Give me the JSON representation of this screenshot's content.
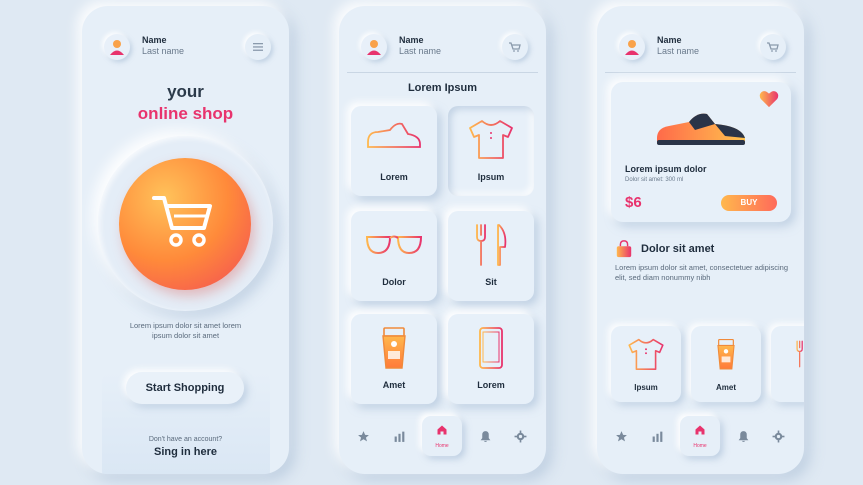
{
  "colors": {
    "accent": "#e8336d",
    "orange": "#ff8a3a",
    "background": "#dfe9f3",
    "panel": "#e6eff8"
  },
  "user": {
    "name": "Name",
    "last": "Last name"
  },
  "screen1": {
    "title_line1": "your",
    "title_line2": "online shop",
    "description": "Lorem ipsum dolor sit amet lorem ipsum dolor sit amet",
    "start_button": "Start Shopping",
    "no_account": "Don't have an account?",
    "sign_in": "Sing in here",
    "header_icon": "menu-icon"
  },
  "screen2": {
    "title": "Lorem Ipsum",
    "header_icon": "cart-icon",
    "categories": [
      {
        "label": "Lorem",
        "icon": "sneaker-icon"
      },
      {
        "label": "Ipsum",
        "icon": "tshirt-icon"
      },
      {
        "label": "Dolor",
        "icon": "glasses-icon"
      },
      {
        "label": "Sit",
        "icon": "cutlery-icon"
      },
      {
        "label": "Amet",
        "icon": "cream-tube-icon"
      },
      {
        "label": "Lorem",
        "icon": "phone-icon"
      }
    ]
  },
  "screen3": {
    "header_icon": "cart-icon",
    "product": {
      "name": "Lorem ipsum dolor",
      "subtitle": "Dolor sit amet: 300 ml",
      "price": "$6",
      "buy": "BUY"
    },
    "section_title": "Dolor sit amet",
    "section_desc": "Lorem ipsum dolor sit amet, consectetuer adipiscing elit, sed diam nonummy nibh",
    "items": [
      {
        "label": "Ipsum",
        "icon": "tshirt-icon"
      },
      {
        "label": "Amet",
        "icon": "cream-tube-icon"
      }
    ]
  },
  "tabbar": {
    "home_label": "Home",
    "icons": [
      "star-icon",
      "chart-icon",
      "home-icon",
      "bell-icon",
      "settings-icon"
    ]
  }
}
